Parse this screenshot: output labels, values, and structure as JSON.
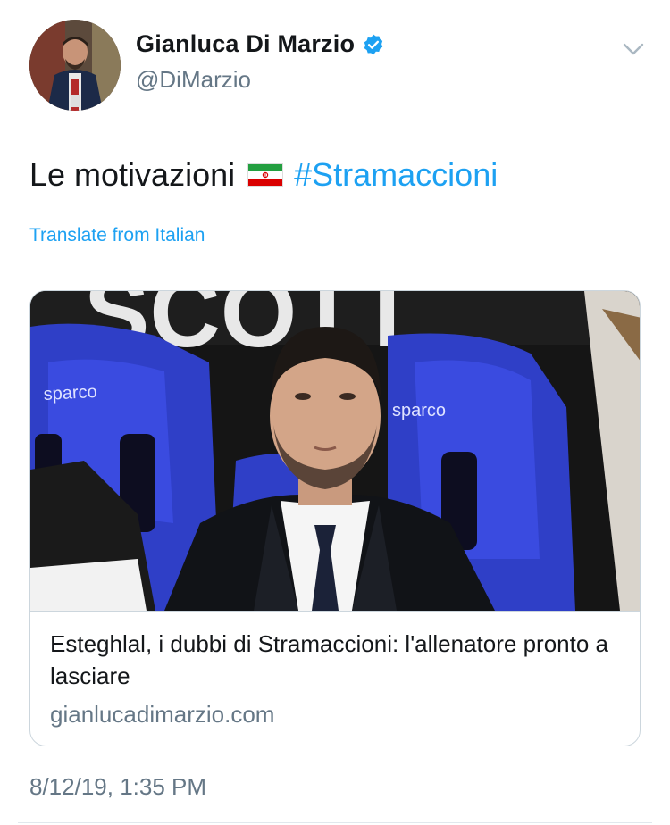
{
  "author": {
    "name": "Gianluca Di Marzio",
    "handle": "@DiMarzio",
    "verified": true
  },
  "tweet": {
    "text": "Le motivazioni",
    "flag_icon": "iran-flag-icon",
    "hashtag": "#Stramaccioni",
    "translate_label": "Translate from Italian",
    "timestamp": "8/12/19, 1:35 PM"
  },
  "card": {
    "title": "Esteghlal, i dubbi di Stramaccioni: l'allenatore pronto a lasciare",
    "domain": "gianlucadimarzio.com",
    "image_text": {
      "seat_brand": "sparco",
      "banner": "SCOTT"
    }
  },
  "colors": {
    "accent": "#1da1f2",
    "secondary_text": "#657786",
    "primary_text": "#14171a",
    "seat_blue": "#2f3fc7"
  }
}
